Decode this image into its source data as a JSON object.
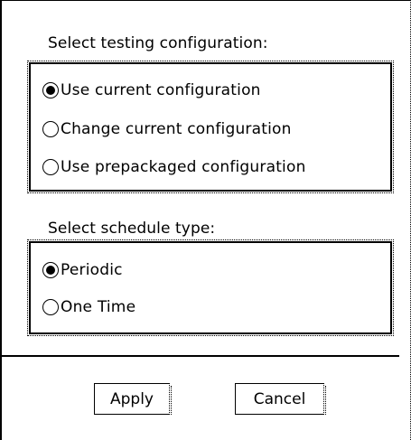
{
  "testing_config": {
    "label": "Select testing configuration:",
    "options": [
      {
        "label": "Use current configuration",
        "checked": true
      },
      {
        "label": "Change current configuration",
        "checked": false
      },
      {
        "label": "Use prepackaged configuration",
        "checked": false
      }
    ]
  },
  "schedule": {
    "label": "Select schedule type:",
    "options": [
      {
        "label": "Periodic",
        "checked": true
      },
      {
        "label": "One Time",
        "checked": false
      }
    ]
  },
  "buttons": {
    "apply": "Apply",
    "cancel": "Cancel"
  }
}
